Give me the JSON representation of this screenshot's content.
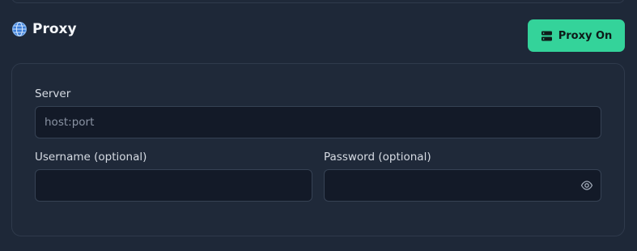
{
  "section": {
    "title": "Proxy",
    "toggle_label": "Proxy On",
    "toggle_color": "#34d39a"
  },
  "form": {
    "server": {
      "label": "Server",
      "placeholder": "host:port",
      "value": ""
    },
    "username": {
      "label": "Username (optional)",
      "placeholder": "",
      "value": ""
    },
    "password": {
      "label": "Password (optional)",
      "placeholder": "",
      "value": ""
    }
  },
  "icons": {
    "title_icon": "globe-icon",
    "toggle_icon": "server-icon",
    "password_icon": "eye-icon"
  }
}
